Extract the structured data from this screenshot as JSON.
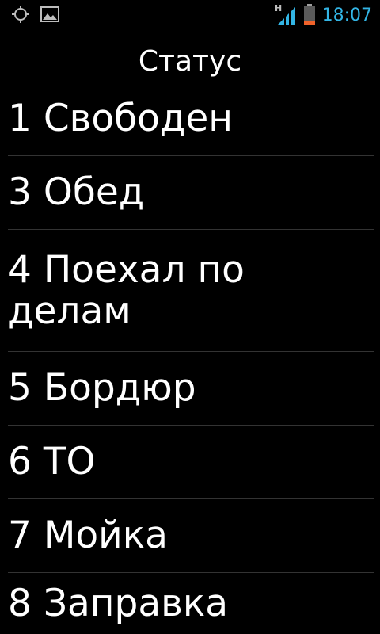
{
  "status_bar": {
    "time": "18:07",
    "network_type": "H",
    "icons": {
      "left": [
        "gps-icon",
        "image-notification-icon"
      ],
      "right": [
        "signal-icon",
        "battery-icon"
      ]
    },
    "accent_color": "#33b5e5",
    "battery_color": "#f0622a"
  },
  "dialog": {
    "title": "Статус",
    "items": [
      {
        "label": "1 Свободен"
      },
      {
        "label": "3 Обед"
      },
      {
        "label_line1": "4 Поехал по",
        "label_line2": "делам"
      },
      {
        "label": "5 Бордюр"
      },
      {
        "label": "6 ТО"
      },
      {
        "label": "7 Мойка"
      },
      {
        "label": "8 Заправка"
      }
    ]
  }
}
